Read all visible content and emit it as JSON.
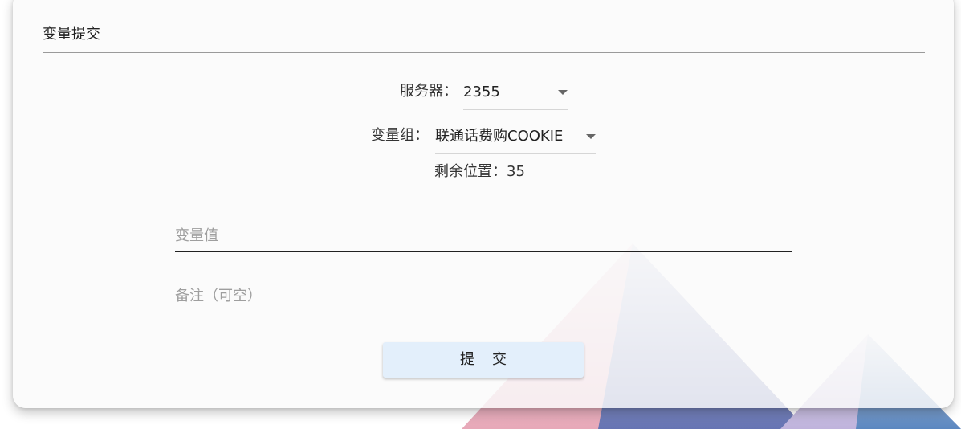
{
  "card": {
    "title": "变量提交"
  },
  "server": {
    "label": "服务器：",
    "value": "2355"
  },
  "variable_group": {
    "label": "变量组：",
    "value": "联通话费购COOKIE"
  },
  "remaining": {
    "text": "剩余位置：35"
  },
  "inputs": {
    "variable_value_placeholder": "变量值",
    "note_placeholder": "备注（可空）"
  },
  "submit": {
    "label": "提交"
  },
  "colors": {
    "card_background": "#fafafa",
    "button_background": "#e3effb",
    "triangle_pink": "#f2c9d3",
    "triangle_blue": "#6f7fb6",
    "triangle_lavender": "#c9c1e2",
    "triangle_steelblue": "#5b8cc2"
  },
  "icons": [
    "caret-down-icon"
  ]
}
